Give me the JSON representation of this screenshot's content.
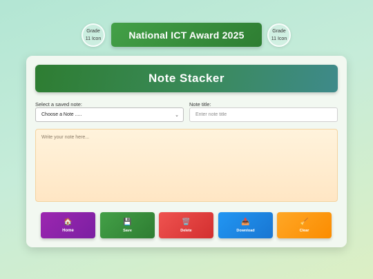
{
  "header": {
    "badge_left": {
      "line1": "Grade",
      "line2": "11 Icon"
    },
    "award_title": "National ICT Award 2025",
    "badge_right": {
      "line1": "Grade",
      "line2": "11 Icon"
    }
  },
  "app": {
    "title": "Note Stacker",
    "saved_note": {
      "label": "Select a saved note:",
      "selected": "Choose a Note ....."
    },
    "note_title": {
      "label": "Note title:",
      "placeholder": "Enter note title",
      "value": ""
    },
    "note_body": {
      "placeholder": "Write your note here...",
      "value": ""
    },
    "buttons": [
      {
        "label": "Home",
        "icon": "🏠",
        "icon_name": "home-icon"
      },
      {
        "label": "Save",
        "icon": "💾",
        "icon_name": "floppy-disk-icon"
      },
      {
        "label": "Delete",
        "icon": "🗑️",
        "icon_name": "trash-icon"
      },
      {
        "label": "Download",
        "icon": "📥",
        "icon_name": "download-tray-icon"
      },
      {
        "label": "Clear",
        "icon": "🧹",
        "icon_name": "broom-icon"
      }
    ]
  },
  "colors": {
    "home": "#9c27b0",
    "save": "#43a047",
    "delete": "#e53935",
    "download": "#1e88e5",
    "clear": "#fb8c00",
    "banner": "#2e7d32"
  }
}
